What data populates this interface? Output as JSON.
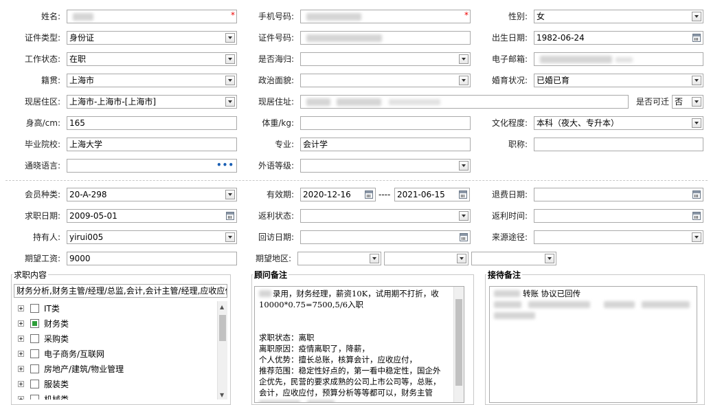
{
  "personal": {
    "name_label": "姓名:",
    "phone_label": "手机号码:",
    "gender_label": "性别:",
    "gender_value": "女",
    "id_type_label": "证件类型:",
    "id_type_value": "身份证",
    "id_no_label": "证件号码:",
    "birth_label": "出生日期:",
    "birth_value": "1982-06-24",
    "work_status_label": "工作状态:",
    "work_status_value": "在职",
    "overseas_label": "是否海归:",
    "email_label": "电子邮箱:",
    "native_label": "籍贯:",
    "native_value": "上海市",
    "political_label": "政治面貌:",
    "marital_label": "婚育状况:",
    "marital_value": "已婚已育",
    "residence_area_label": "现居住区:",
    "residence_area_value": "上海市-上海市-[上海市]",
    "residence_addr_label": "现居住址:",
    "relocate_label": "是否可迁",
    "relocate_value": "否",
    "height_label": "身高/cm:",
    "height_value": "165",
    "weight_label": "体重/kg:",
    "education_label": "文化程度:",
    "education_value": "本科（夜大、专升本）",
    "school_label": "毕业院校:",
    "school_value": "上海大学",
    "major_label": "专业:",
    "major_value": "会计学",
    "title_label": "职称:",
    "language_label": "通晓语言:",
    "language_ellipsis": "•••",
    "foreign_level_label": "外语等级:"
  },
  "membership": {
    "member_type_label": "会员种类:",
    "member_type_value": "20-A-298",
    "valid_label": "有效期:",
    "valid_from": "2020-12-16",
    "valid_sep": "----",
    "valid_to": "2021-06-15",
    "refund_date_label": "退费日期:",
    "job_date_label": "求职日期:",
    "job_date_value": "2009-05-01",
    "rebate_status_label": "返利状态:",
    "rebate_time_label": "返利时间:",
    "holder_label": "持有人:",
    "holder_value": "yirui005",
    "visit_date_label": "回访日期:",
    "source_label": "来源途径:",
    "salary_label": "期望工资:",
    "salary_value": "9000",
    "region_label": "期望地区:"
  },
  "job_panel": {
    "title": "求职内容",
    "summary": "财务分析,财务主管/经理/总监,会计,会计主管/经理,应收应付",
    "tree": [
      {
        "label": "IT类",
        "state": "none"
      },
      {
        "label": "财务类",
        "state": "partial"
      },
      {
        "label": "采购类",
        "state": "none"
      },
      {
        "label": "电子商务/互联网",
        "state": "none"
      },
      {
        "label": "房地产/建筑/物业管理",
        "state": "none"
      },
      {
        "label": "服装类",
        "state": "none"
      },
      {
        "label": "机械类",
        "state": "none"
      }
    ]
  },
  "advisor_panel": {
    "title": "顾问备注",
    "line1": "录用，财务经理，薪资10K，试用期不打折，收",
    "line2": "10000*0.75=7500,5/6入职",
    "line3": "求职状态：离职",
    "line4": "离职原因：疫情离职了，降薪，",
    "line5": "个人优势：擅长总账，核算会计，应收应付，",
    "line6": "推荐范围：稳定性好点的，第一看中稳定性，国企外",
    "line7": "企优先，民营的要求成熟的公司上市公司等，总账，",
    "line8": "会计，应收应付，预算分析等等都可以，财务主管"
  },
  "reception_panel": {
    "title": "接待备注",
    "line1": "转账 协议已回传"
  },
  "colors": {
    "required": "#e00000",
    "checkbox_partial": "#2e9e3a",
    "ellipsis": "#1a5fb4"
  }
}
